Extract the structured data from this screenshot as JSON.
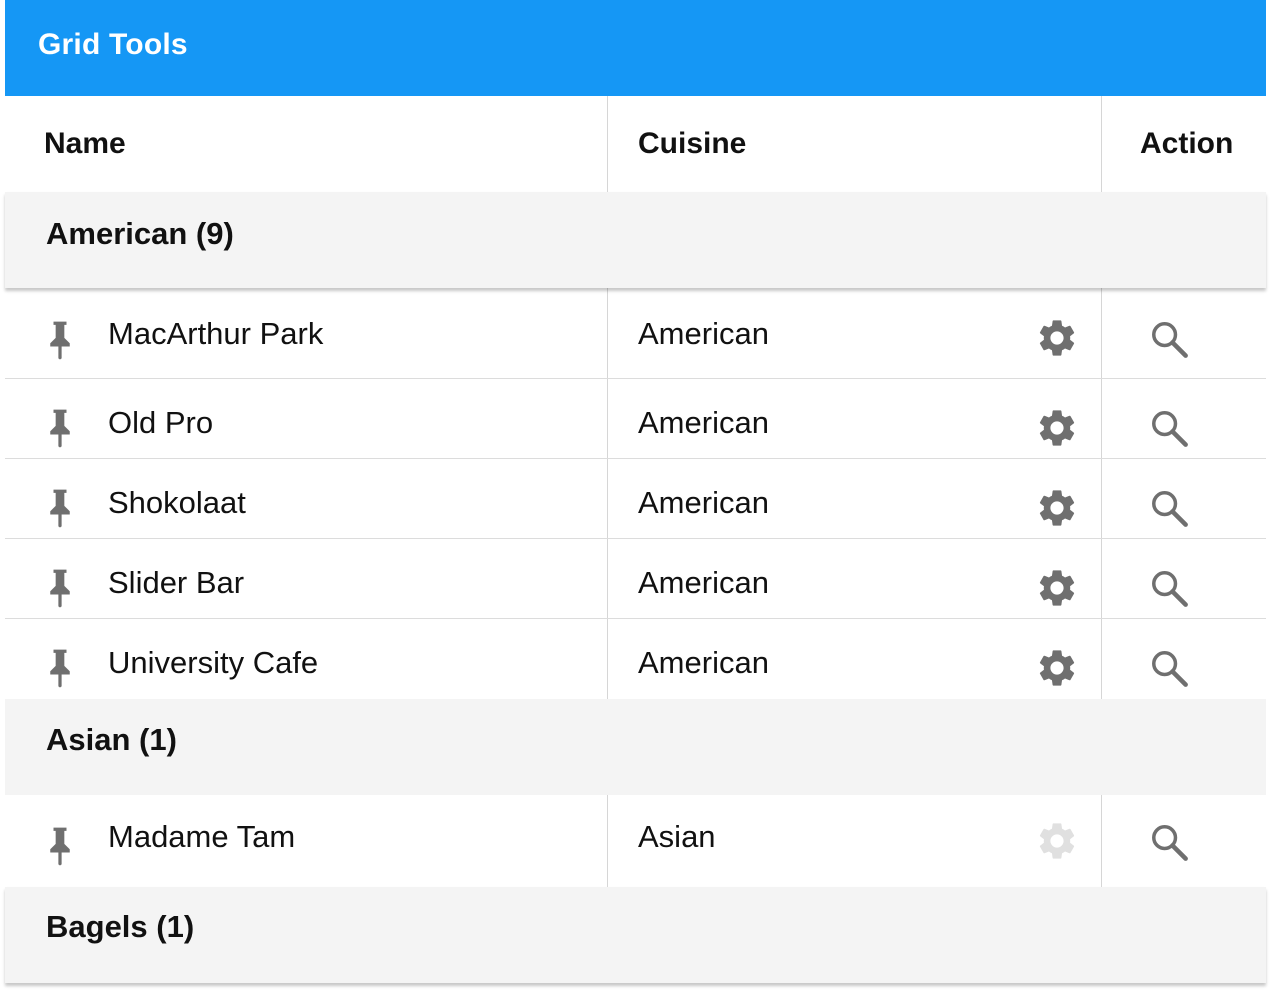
{
  "app": {
    "title": "Grid Tools"
  },
  "columns": {
    "name": "Name",
    "cuisine": "Cuisine",
    "action": "Action"
  },
  "colors": {
    "header": "#1597f5",
    "icon": "#6f6f6f",
    "icon_disabled": "#e0e0e0",
    "group_bg": "#f4f4f4"
  },
  "groups": [
    {
      "label": "American (9)",
      "rows": [
        {
          "name": "MacArthur Park",
          "cuisine": "American",
          "gear_enabled": true
        },
        {
          "name": "Old Pro",
          "cuisine": "American",
          "gear_enabled": true
        },
        {
          "name": "Shokolaat",
          "cuisine": "American",
          "gear_enabled": true
        },
        {
          "name": "Slider Bar",
          "cuisine": "American",
          "gear_enabled": true
        },
        {
          "name": "University Cafe",
          "cuisine": "American",
          "gear_enabled": true
        }
      ]
    },
    {
      "label": "Asian (1)",
      "rows": [
        {
          "name": "Madame Tam",
          "cuisine": "Asian",
          "gear_enabled": false
        }
      ]
    },
    {
      "label": "Bagels (1)",
      "rows": []
    }
  ],
  "icons": {
    "pin": "pin-icon",
    "gear": "gear-icon",
    "search": "search-icon"
  }
}
